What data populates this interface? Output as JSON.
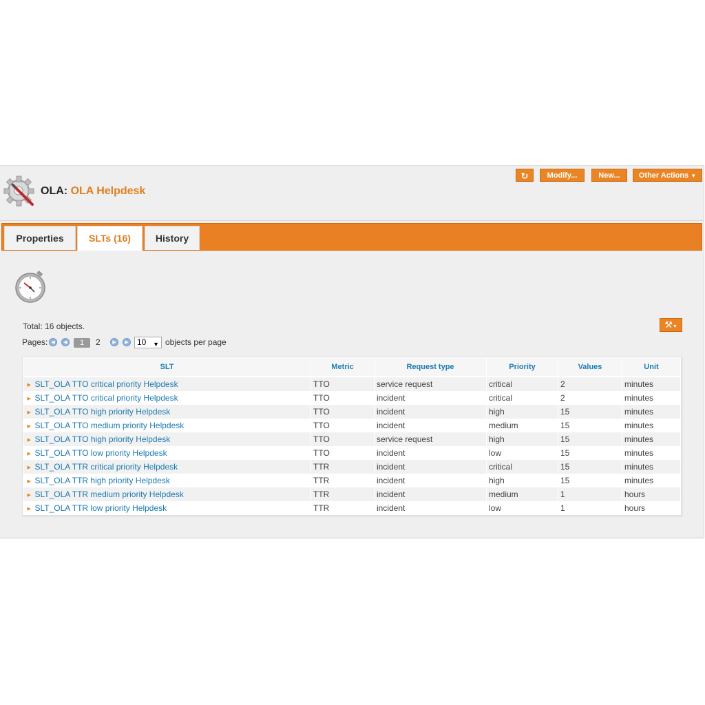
{
  "header": {
    "class_label": "OLA:",
    "object_name": "OLA Helpdesk",
    "buttons": {
      "refresh_icon": "refresh-icon",
      "modify": "Modify...",
      "new": "New...",
      "other_actions": "Other Actions"
    }
  },
  "tabs": [
    {
      "label": "Properties",
      "active": false
    },
    {
      "label": "SLTs (16)",
      "active": true
    },
    {
      "label": "History",
      "active": false
    }
  ],
  "list": {
    "total": "Total: 16 objects.",
    "pages_label": "Pages:",
    "current_page": "1",
    "other_page": "2",
    "per_page_value": "10",
    "per_page_label": "objects per page",
    "columns": [
      "SLT",
      "Metric",
      "Request type",
      "Priority",
      "Values",
      "Unit"
    ],
    "rows": [
      [
        "SLT_OLA TTO critical priority Helpdesk",
        "TTO",
        "service request",
        "critical",
        "2",
        "minutes"
      ],
      [
        "SLT_OLA TTO critical priority Helpdesk",
        "TTO",
        "incident",
        "critical",
        "2",
        "minutes"
      ],
      [
        "SLT_OLA TTO high priority Helpdesk",
        "TTO",
        "incident",
        "high",
        "15",
        "minutes"
      ],
      [
        "SLT_OLA TTO medium priority Helpdesk",
        "TTO",
        "incident",
        "medium",
        "15",
        "minutes"
      ],
      [
        "SLT_OLA TTO high priority Helpdesk",
        "TTO",
        "service request",
        "high",
        "15",
        "minutes"
      ],
      [
        "SLT_OLA TTO low priority Helpdesk",
        "TTO",
        "incident",
        "low",
        "15",
        "minutes"
      ],
      [
        "SLT_OLA TTR critical priority Helpdesk",
        "TTR",
        "incident",
        "critical",
        "15",
        "minutes"
      ],
      [
        "SLT_OLA TTR high priority Helpdesk",
        "TTR",
        "incident",
        "high",
        "15",
        "minutes"
      ],
      [
        "SLT_OLA TTR medium priority Helpdesk",
        "TTR",
        "incident",
        "medium",
        "1",
        "hours"
      ],
      [
        "SLT_OLA TTR low priority Helpdesk",
        "TTR",
        "incident",
        "low",
        "1",
        "hours"
      ]
    ]
  },
  "colors": {
    "accent": "#e98524",
    "link": "#1b7ab0",
    "title_highlight": "#e07e1c"
  }
}
